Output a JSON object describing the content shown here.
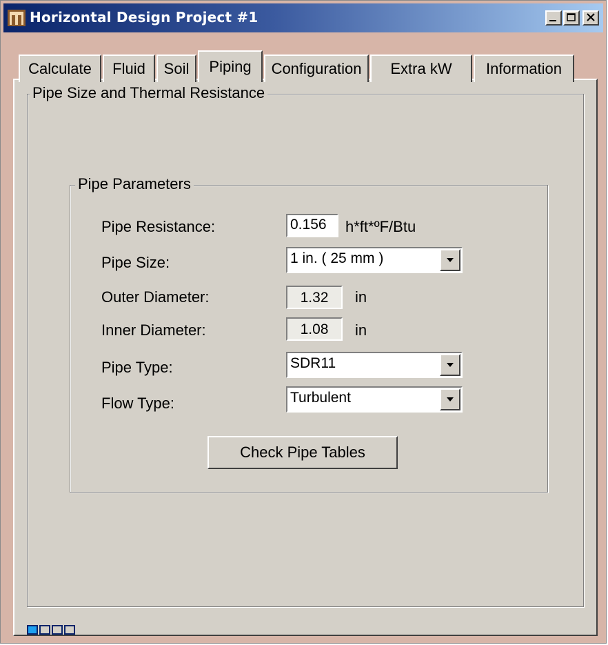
{
  "window": {
    "title": "Horizontal Design Project #1",
    "controls": [
      "minimize",
      "maximize",
      "close"
    ]
  },
  "tabs": [
    {
      "label": "Calculate",
      "active": false
    },
    {
      "label": "Fluid",
      "active": false
    },
    {
      "label": "Soil",
      "active": false
    },
    {
      "label": "Piping",
      "active": true
    },
    {
      "label": "Configuration",
      "active": false
    },
    {
      "label": "Extra kW",
      "active": false
    },
    {
      "label": "Information",
      "active": false
    }
  ],
  "outer_group": {
    "label": "Pipe Size and Thermal Resistance"
  },
  "inner_group": {
    "label": "Pipe Parameters",
    "pipe_resistance": {
      "label": "Pipe Resistance:",
      "value": "0.156",
      "unit": "h*ft*ºF/Btu"
    },
    "pipe_size": {
      "label": "Pipe Size:",
      "value": "1 in. ( 25 mm )"
    },
    "outer_diameter": {
      "label": "Outer Diameter:",
      "value": "1.32",
      "unit": "in"
    },
    "inner_diameter": {
      "label": "Inner Diameter:",
      "value": "1.08",
      "unit": "in"
    },
    "pipe_type": {
      "label": "Pipe Type:",
      "value": "SDR11"
    },
    "flow_type": {
      "label": "Flow Type:",
      "value": "Turbulent"
    },
    "check_button": "Check Pipe Tables"
  },
  "status": {
    "progress_cells_filled": 1,
    "progress_cells_total": 4
  },
  "colors": {
    "title_start": "#0a246a",
    "title_end": "#a6caf0",
    "face": "#d4d0c8",
    "frame": "#d7b5a8",
    "progress": "#1ea0f0"
  }
}
